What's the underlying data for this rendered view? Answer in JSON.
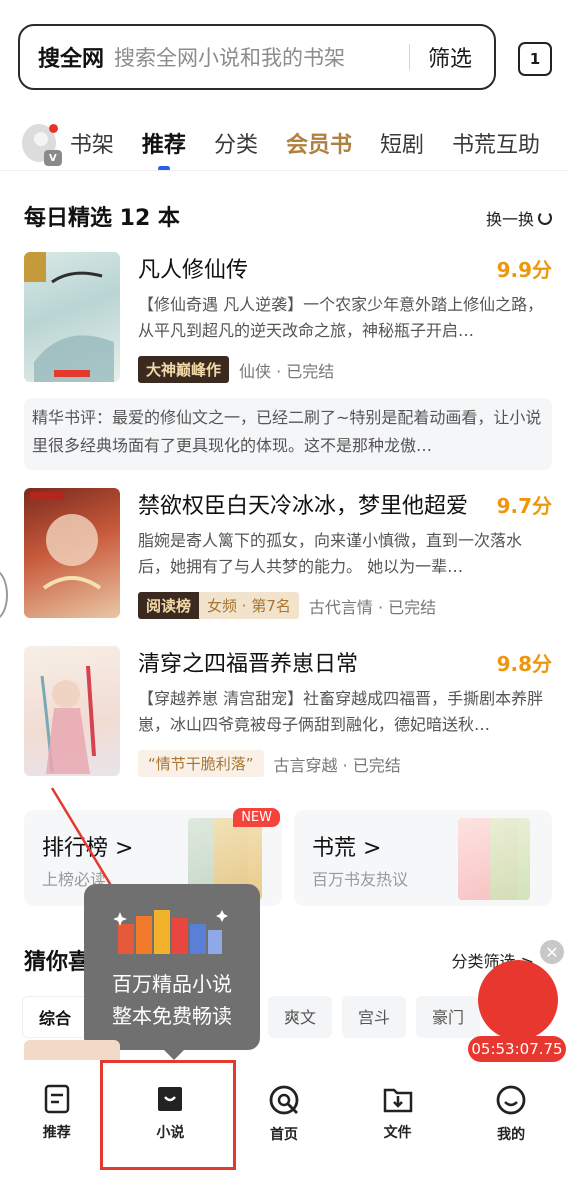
{
  "search": {
    "scope": "搜全网",
    "placeholder": "搜索全网小说和我的书架",
    "filter_label": "筛选",
    "tab_count": "1"
  },
  "tabs": [
    {
      "label": "书架"
    },
    {
      "label": "推荐"
    },
    {
      "label": "分类"
    },
    {
      "label": "会员书"
    },
    {
      "label": "短剧"
    },
    {
      "label": "书荒互助"
    }
  ],
  "avatar_badge": "V",
  "daily": {
    "title": "每日精选 12 本",
    "refresh_label": "换一换"
  },
  "books": [
    {
      "title": "凡人修仙传",
      "score": "9.9分",
      "desc": "【修仙奇遇 凡人逆袭】一个农家少年意外踏上修仙之路，从平凡到超凡的逆天改命之旅，神秘瓶子开启…",
      "tag": "大神巅峰作",
      "meta": "仙侠 · 已完结"
    },
    {
      "title": "禁欲权臣白天冷冰冰，梦里他超爱",
      "score": "9.7分",
      "desc": "脂婉是寄人篱下的孤女，向来谨小慎微，直到一次落水后，她拥有了与人共梦的能力。     她以为一辈…",
      "tag": "阅读榜",
      "rank": "女频 · 第7名",
      "meta": "古代言情 · 已完结"
    },
    {
      "title": "清穿之四福晋养崽日常",
      "score": "9.8分",
      "desc": "【穿越养崽 清宫甜宠】社畜穿越成四福晋，手撕剧本养胖崽，冰山四爷竟被母子俩甜到融化，德妃暗送秋…",
      "tag": "“情节干脆利落”",
      "meta": "古言穿越 · 已完结"
    }
  ],
  "review": "精华书评：最爱的修仙文之一，已经二刷了~特别是配着动画看，让小说里很多经典场面有了更具现化的体现。这不是那种龙傲…",
  "cards": [
    {
      "title": "排行榜 >",
      "sub": "上榜必读",
      "badge": "NEW"
    },
    {
      "title": "书荒 >",
      "sub": "百万书友热议"
    }
  ],
  "guess": {
    "title": "猜你喜",
    "filter": "分类筛选 >",
    "chips": [
      "综合",
      "",
      "爽文",
      "宫斗",
      "豪门"
    ]
  },
  "tooltip": {
    "line1": "百万精品小说",
    "line2": "整本免费畅读"
  },
  "float_timer": "05:53:07.75",
  "nav": [
    {
      "label": "推荐",
      "icon": "document-icon"
    },
    {
      "label": "小说",
      "icon": "book-icon"
    },
    {
      "label": "首页",
      "icon": "home-q-icon"
    },
    {
      "label": "文件",
      "icon": "folder-download-icon"
    },
    {
      "label": "我的",
      "icon": "smile-icon"
    }
  ],
  "colors": {
    "accent_blue": "#2a60e8",
    "score_orange": "#f0960a",
    "gold_tab": "#b08040",
    "highlight_red": "#e23a2e"
  }
}
